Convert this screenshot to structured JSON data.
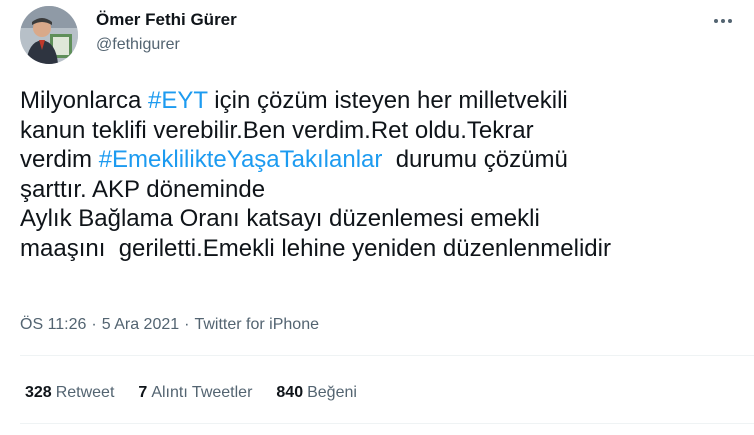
{
  "author": {
    "name": "Ömer Fethi Gürer",
    "handle": "@fethigurer"
  },
  "tweet": {
    "segments": [
      {
        "text": "Milyonlarca ",
        "hashtag": false
      },
      {
        "text": "#EYT",
        "hashtag": true
      },
      {
        "text": " için çözüm isteyen her milletvekili\nkanun teklifi verebilir.Ben verdim.Ret oldu.Tekrar\nverdim ",
        "hashtag": false
      },
      {
        "text": "#EmeklilikteYaşaTakılanlar",
        "hashtag": true
      },
      {
        "text": "  durumu çözümü\nşarttır. AKP döneminde\nAylık Bağlama Oranı katsayı düzenlemesi emekli\nmaaşını  geriletti.Emekli lehine yeniden düzenlenmelidir",
        "hashtag": false
      }
    ]
  },
  "meta": {
    "time": "ÖS 11:26",
    "date": "5 Ara 2021",
    "separator": "·",
    "source": "Twitter for iPhone"
  },
  "stats": {
    "retweets": {
      "count": "328",
      "label": "Retweet"
    },
    "quotes": {
      "count": "7",
      "label": "Alıntı Tweetler"
    },
    "likes": {
      "count": "840",
      "label": "Beğeni"
    }
  },
  "colors": {
    "hashtag": "#1d9bf0",
    "text": "#0f1419",
    "secondary": "#536471",
    "divider": "#eff3f4"
  },
  "icons": {
    "more": "more-horizontal-icon"
  }
}
